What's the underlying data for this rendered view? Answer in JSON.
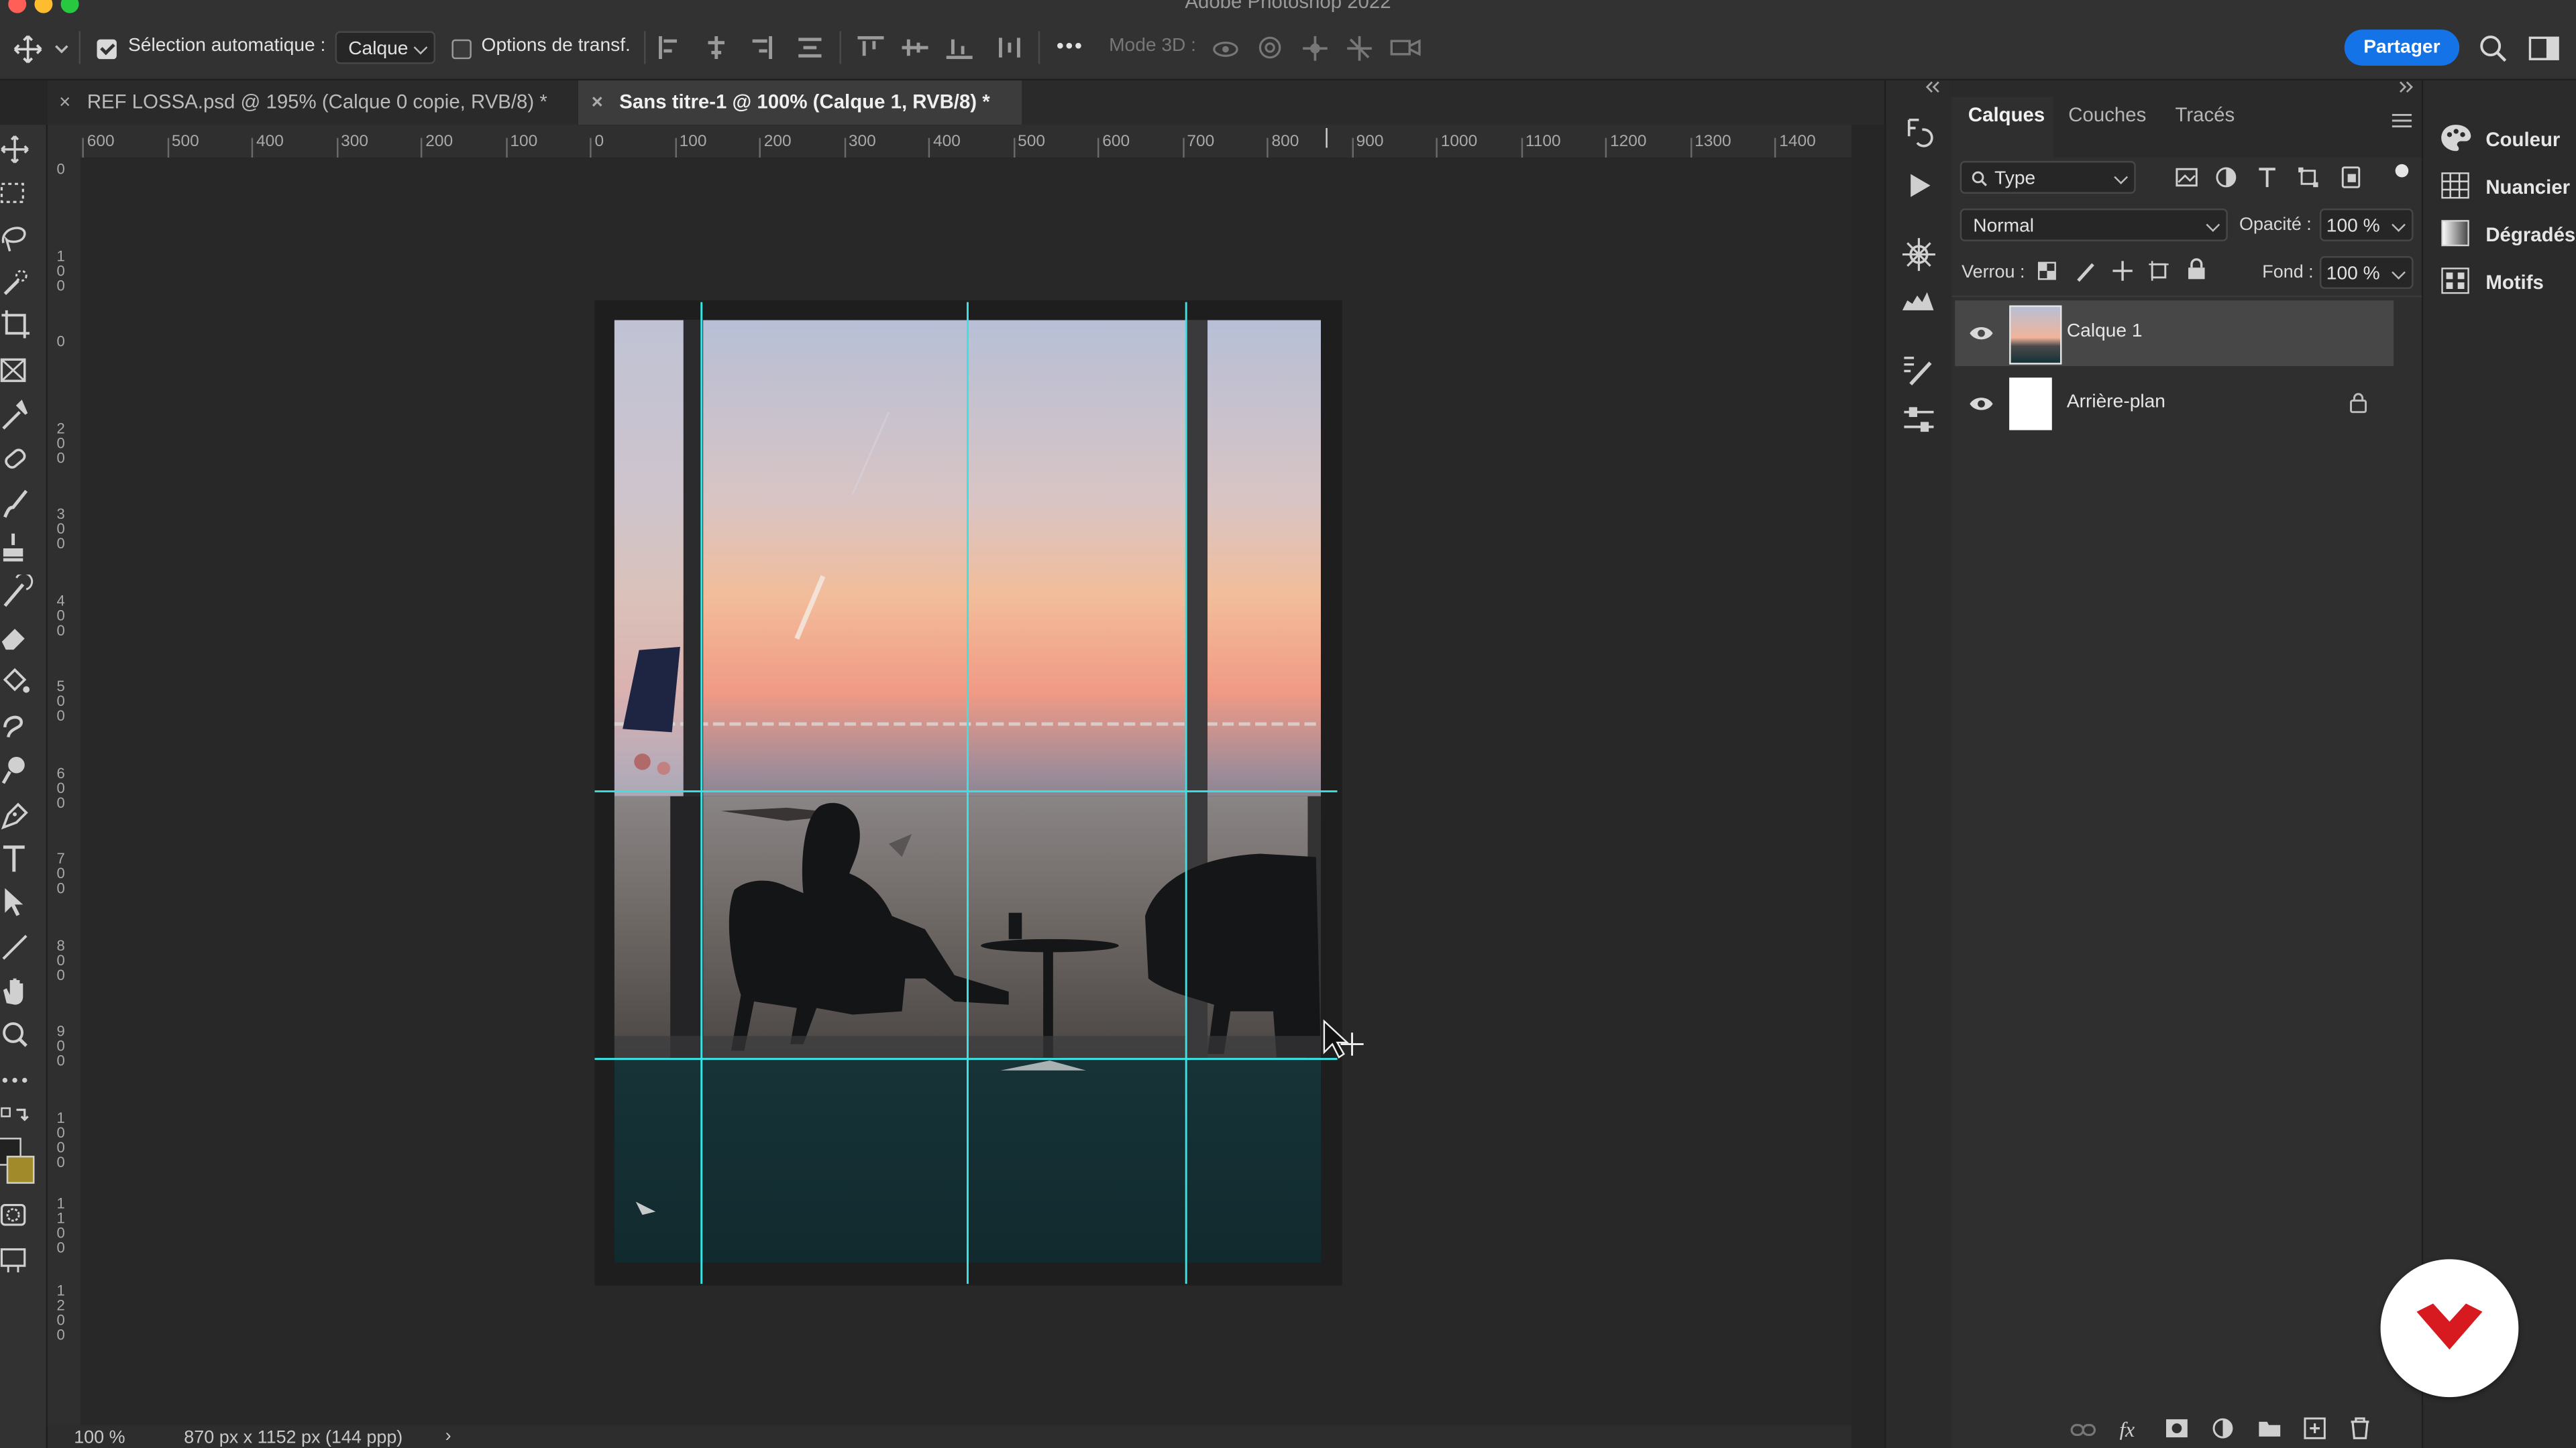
{
  "app": {
    "title": "Adobe Photoshop 2022"
  },
  "options_bar": {
    "auto_select_label": "Sélection automatique :",
    "auto_select_checked": true,
    "layer_dropdown": "Calque",
    "transform_options_label": "Options de transf.",
    "transform_options_checked": false,
    "more_label": "•••",
    "mode3d_label": "Mode 3D :",
    "share_label": "Partager"
  },
  "document_tabs": [
    {
      "label": "REF LOSSA.psd @ 195% (Calque 0 copie, RVB/8) *",
      "close": "×",
      "active": false
    },
    {
      "label": "Sans titre-1 @ 100% (Calque 1, RVB/8) *",
      "close": "×",
      "active": true
    }
  ],
  "rulers": {
    "horizontal": [
      "600",
      "500",
      "400",
      "300",
      "200",
      "100",
      "0",
      "100",
      "200",
      "300",
      "400",
      "500",
      "600",
      "700",
      "800",
      "900",
      "1000",
      "1100",
      "1200",
      "1300",
      "1400"
    ],
    "vertical": [
      "0",
      "100",
      "0",
      "200",
      "300",
      "400",
      "500",
      "600",
      "700",
      "800",
      "900",
      "1000",
      "1100",
      "1200"
    ]
  },
  "status_bar": {
    "zoom": "100 %",
    "doc_info": "870 px x 1152 px (144 ppp)",
    "arrow": "›"
  },
  "layers_panel": {
    "tabs": [
      "Calques",
      "Couches",
      "Tracés"
    ],
    "active_tab": "Calques",
    "filter_label": "Type",
    "blend_mode": "Normal",
    "opacity_label": "Opacité :",
    "opacity_value": "100 %",
    "lock_label": "Verrou :",
    "fill_label": "Fond :",
    "fill_value": "100 %",
    "layers": [
      {
        "name": "Calque 1",
        "visible": true,
        "selected": true,
        "locked": false
      },
      {
        "name": "Arrière-plan",
        "visible": true,
        "selected": false,
        "locked": true
      }
    ]
  },
  "side_panels": [
    {
      "label": "Couleur",
      "icon": "palette-icon"
    },
    {
      "label": "Nuancier",
      "icon": "swatches-grid-icon"
    },
    {
      "label": "Dégradés",
      "icon": "gradient-icon"
    },
    {
      "label": "Motifs",
      "icon": "patterns-icon"
    }
  ],
  "colors": {
    "accent": "#1473e6",
    "guide": "#39e3e3",
    "background_color_swatch": "#a08a2a",
    "brand_badge": "#d71920"
  }
}
